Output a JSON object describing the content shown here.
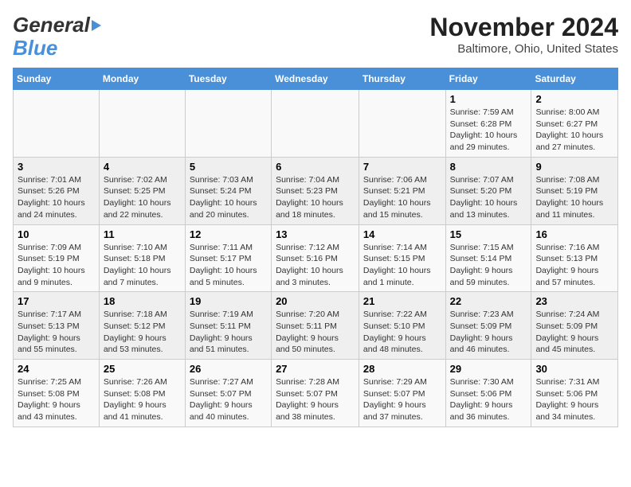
{
  "header": {
    "logo_line1": "General",
    "logo_line2": "Blue",
    "month_title": "November 2024",
    "location": "Baltimore, Ohio, United States"
  },
  "weekdays": [
    "Sunday",
    "Monday",
    "Tuesday",
    "Wednesday",
    "Thursday",
    "Friday",
    "Saturday"
  ],
  "weeks": [
    [
      {
        "day": "",
        "info": ""
      },
      {
        "day": "",
        "info": ""
      },
      {
        "day": "",
        "info": ""
      },
      {
        "day": "",
        "info": ""
      },
      {
        "day": "",
        "info": ""
      },
      {
        "day": "1",
        "info": "Sunrise: 7:59 AM\nSunset: 6:28 PM\nDaylight: 10 hours and 29 minutes."
      },
      {
        "day": "2",
        "info": "Sunrise: 8:00 AM\nSunset: 6:27 PM\nDaylight: 10 hours and 27 minutes."
      }
    ],
    [
      {
        "day": "3",
        "info": "Sunrise: 7:01 AM\nSunset: 5:26 PM\nDaylight: 10 hours and 24 minutes."
      },
      {
        "day": "4",
        "info": "Sunrise: 7:02 AM\nSunset: 5:25 PM\nDaylight: 10 hours and 22 minutes."
      },
      {
        "day": "5",
        "info": "Sunrise: 7:03 AM\nSunset: 5:24 PM\nDaylight: 10 hours and 20 minutes."
      },
      {
        "day": "6",
        "info": "Sunrise: 7:04 AM\nSunset: 5:23 PM\nDaylight: 10 hours and 18 minutes."
      },
      {
        "day": "7",
        "info": "Sunrise: 7:06 AM\nSunset: 5:21 PM\nDaylight: 10 hours and 15 minutes."
      },
      {
        "day": "8",
        "info": "Sunrise: 7:07 AM\nSunset: 5:20 PM\nDaylight: 10 hours and 13 minutes."
      },
      {
        "day": "9",
        "info": "Sunrise: 7:08 AM\nSunset: 5:19 PM\nDaylight: 10 hours and 11 minutes."
      }
    ],
    [
      {
        "day": "10",
        "info": "Sunrise: 7:09 AM\nSunset: 5:19 PM\nDaylight: 10 hours and 9 minutes."
      },
      {
        "day": "11",
        "info": "Sunrise: 7:10 AM\nSunset: 5:18 PM\nDaylight: 10 hours and 7 minutes."
      },
      {
        "day": "12",
        "info": "Sunrise: 7:11 AM\nSunset: 5:17 PM\nDaylight: 10 hours and 5 minutes."
      },
      {
        "day": "13",
        "info": "Sunrise: 7:12 AM\nSunset: 5:16 PM\nDaylight: 10 hours and 3 minutes."
      },
      {
        "day": "14",
        "info": "Sunrise: 7:14 AM\nSunset: 5:15 PM\nDaylight: 10 hours and 1 minute."
      },
      {
        "day": "15",
        "info": "Sunrise: 7:15 AM\nSunset: 5:14 PM\nDaylight: 9 hours and 59 minutes."
      },
      {
        "day": "16",
        "info": "Sunrise: 7:16 AM\nSunset: 5:13 PM\nDaylight: 9 hours and 57 minutes."
      }
    ],
    [
      {
        "day": "17",
        "info": "Sunrise: 7:17 AM\nSunset: 5:13 PM\nDaylight: 9 hours and 55 minutes."
      },
      {
        "day": "18",
        "info": "Sunrise: 7:18 AM\nSunset: 5:12 PM\nDaylight: 9 hours and 53 minutes."
      },
      {
        "day": "19",
        "info": "Sunrise: 7:19 AM\nSunset: 5:11 PM\nDaylight: 9 hours and 51 minutes."
      },
      {
        "day": "20",
        "info": "Sunrise: 7:20 AM\nSunset: 5:11 PM\nDaylight: 9 hours and 50 minutes."
      },
      {
        "day": "21",
        "info": "Sunrise: 7:22 AM\nSunset: 5:10 PM\nDaylight: 9 hours and 48 minutes."
      },
      {
        "day": "22",
        "info": "Sunrise: 7:23 AM\nSunset: 5:09 PM\nDaylight: 9 hours and 46 minutes."
      },
      {
        "day": "23",
        "info": "Sunrise: 7:24 AM\nSunset: 5:09 PM\nDaylight: 9 hours and 45 minutes."
      }
    ],
    [
      {
        "day": "24",
        "info": "Sunrise: 7:25 AM\nSunset: 5:08 PM\nDaylight: 9 hours and 43 minutes."
      },
      {
        "day": "25",
        "info": "Sunrise: 7:26 AM\nSunset: 5:08 PM\nDaylight: 9 hours and 41 minutes."
      },
      {
        "day": "26",
        "info": "Sunrise: 7:27 AM\nSunset: 5:07 PM\nDaylight: 9 hours and 40 minutes."
      },
      {
        "day": "27",
        "info": "Sunrise: 7:28 AM\nSunset: 5:07 PM\nDaylight: 9 hours and 38 minutes."
      },
      {
        "day": "28",
        "info": "Sunrise: 7:29 AM\nSunset: 5:07 PM\nDaylight: 9 hours and 37 minutes."
      },
      {
        "day": "29",
        "info": "Sunrise: 7:30 AM\nSunset: 5:06 PM\nDaylight: 9 hours and 36 minutes."
      },
      {
        "day": "30",
        "info": "Sunrise: 7:31 AM\nSunset: 5:06 PM\nDaylight: 9 hours and 34 minutes."
      }
    ]
  ]
}
